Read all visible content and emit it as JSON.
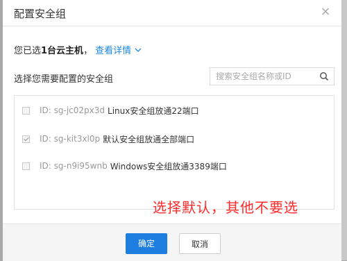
{
  "dialog": {
    "title": "配置安全组",
    "close_icon": "close-icon"
  },
  "selection": {
    "prefix": "您已选",
    "count_text": "1台云主机",
    "separator": "，",
    "details_link": "查看详情",
    "chevron_icon": "chevron-down-icon"
  },
  "choose_label": "选择您需要配置的安全组",
  "search": {
    "placeholder": "搜索安全组名称或ID",
    "icon": "search-icon"
  },
  "security_groups": [
    {
      "id_text": "ID: sg-jc02px3d",
      "name": "Linux安全组放通22端口",
      "checked": false
    },
    {
      "id_text": "ID: sg-kit3xl0p",
      "name": "默认安全组放通全部端口",
      "checked": true
    },
    {
      "id_text": "ID: sg-n9i95wnb",
      "name": "Windows安全组放通3389端口",
      "checked": false
    }
  ],
  "annotation": "选择默认，其他不要选",
  "footer": {
    "ok_label": "确定",
    "cancel_label": "取消"
  },
  "colors": {
    "accent": "#1e7ee0",
    "link": "#1e88e5",
    "annotation": "#ff2a2a"
  }
}
